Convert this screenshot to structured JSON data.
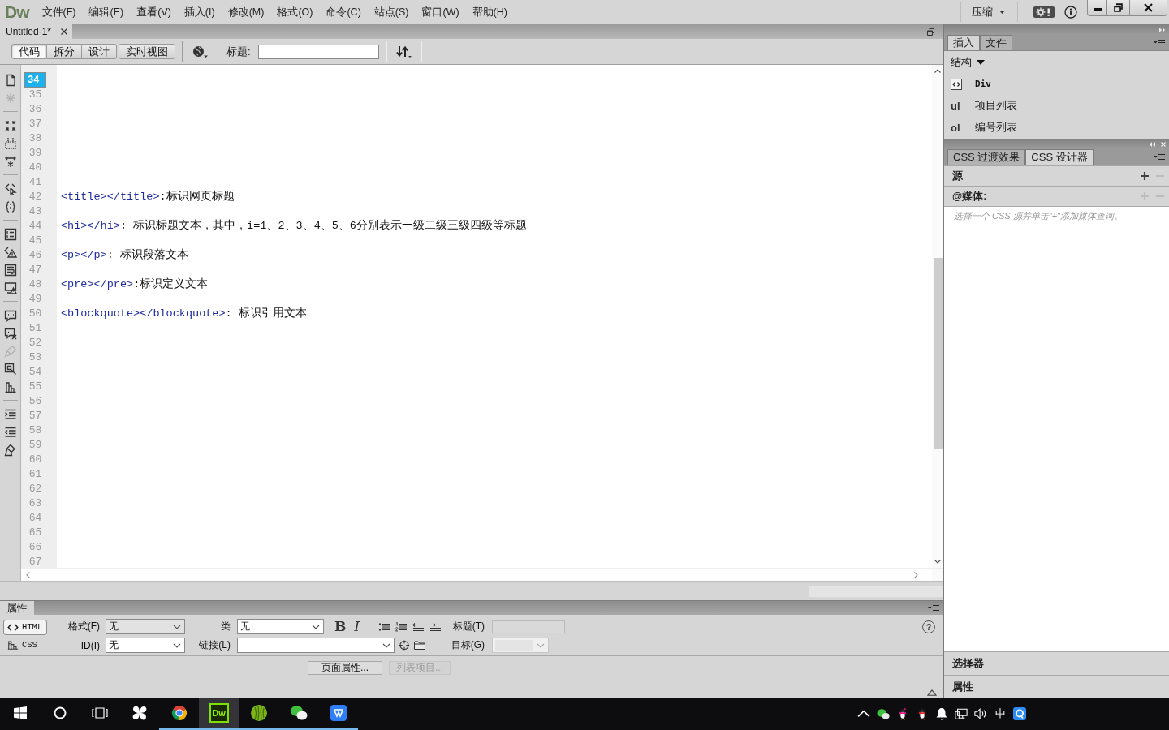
{
  "menu_bar": {
    "logo": "Dw",
    "items": [
      "文件(F)",
      "编辑(E)",
      "查看(V)",
      "插入(I)",
      "修改(M)",
      "格式(O)",
      "命令(C)",
      "站点(S)",
      "窗口(W)",
      "帮助(H)"
    ],
    "workspace": "压缩"
  },
  "document": {
    "title": "Untitled-1*"
  },
  "view_buttons": [
    {
      "label": "代码",
      "selected": true
    },
    {
      "label": "拆分",
      "selected": false
    },
    {
      "label": "设计",
      "selected": false
    },
    {
      "label": "实时视图",
      "selected": false
    }
  ],
  "title_field": {
    "label": "标题:"
  },
  "editor_tools": [
    {
      "tools": [
        {
          "disabled": false
        },
        {
          "disabled": true
        }
      ]
    },
    {
      "tools": [
        {
          "disabled": false
        },
        {
          "disabled": false
        },
        {
          "disabled": false
        }
      ]
    },
    {
      "tools": [
        {
          "disabled": false
        },
        {
          "disabled": false
        }
      ]
    },
    {
      "tools": [
        {
          "disabled": false
        },
        {
          "disabled": false
        },
        {
          "disabled": false
        },
        {
          "disabled": false
        }
      ]
    },
    {
      "tools": [
        {
          "disabled": false
        },
        {
          "disabled": false
        },
        {
          "disabled": true
        },
        {
          "disabled": false
        },
        {
          "disabled": false
        }
      ]
    },
    {
      "tools": [
        {
          "disabled": false
        },
        {
          "disabled": false
        },
        {
          "disabled": false
        }
      ]
    }
  ],
  "editor": {
    "lines": [
      {
        "number": "34",
        "selected": true
      },
      {
        "number": "35",
        "selected": false
      },
      {
        "number": "36",
        "selected": false
      },
      {
        "number": "37",
        "selected": false
      },
      {
        "number": "38",
        "selected": false
      },
      {
        "number": "39",
        "selected": false
      },
      {
        "number": "40",
        "selected": false
      },
      {
        "number": "41",
        "selected": false
      },
      {
        "number": "42",
        "selected": false,
        "tag": "<title></title>",
        "text": ":标识网页标题"
      },
      {
        "number": "43",
        "selected": false
      },
      {
        "number": "44",
        "selected": false,
        "tag": "<hi></hi>",
        "text": ": 标识标题文本，其中，i=1、2、3、4、5、6分别表示一级二级三级四级等标题"
      },
      {
        "number": "45",
        "selected": false
      },
      {
        "number": "46",
        "selected": false,
        "tag": "<p></p>",
        "text": ": 标识段落文本"
      },
      {
        "number": "47",
        "selected": false
      },
      {
        "number": "48",
        "selected": false,
        "tag": "<pre></pre>",
        "text": ":标识定义文本"
      },
      {
        "number": "49",
        "selected": false
      },
      {
        "number": "50",
        "selected": false,
        "tag": "<blockquote></blockquote>",
        "text": ": 标识引用文本"
      },
      {
        "number": "51",
        "selected": false
      },
      {
        "number": "52",
        "selected": false
      },
      {
        "number": "53",
        "selected": false
      },
      {
        "number": "54",
        "selected": false
      },
      {
        "number": "55",
        "selected": false
      },
      {
        "number": "56",
        "selected": false
      },
      {
        "number": "57",
        "selected": false
      },
      {
        "number": "58",
        "selected": false
      },
      {
        "number": "59",
        "selected": false
      },
      {
        "number": "60",
        "selected": false
      },
      {
        "number": "61",
        "selected": false
      },
      {
        "number": "62",
        "selected": false
      },
      {
        "number": "63",
        "selected": false
      },
      {
        "number": "64",
        "selected": false
      },
      {
        "number": "65",
        "selected": false
      },
      {
        "number": "66",
        "selected": false
      },
      {
        "number": "67",
        "selected": false
      }
    ]
  },
  "properties": {
    "title": "属性",
    "modes": [
      {
        "kind": "html",
        "label": "HTML",
        "selected": true
      },
      {
        "kind": "css",
        "label": "CSS",
        "selected": false
      }
    ],
    "format": {
      "label": "格式(F)",
      "value": "无",
      "hovered": true
    },
    "id": {
      "label": "ID(I)",
      "value": "无"
    },
    "class": {
      "label": "类",
      "value": "无"
    },
    "link": {
      "label": "链接(L)"
    },
    "bold": "B",
    "italic": "I",
    "heading": {
      "label": "标题(T)",
      "disabled": true
    },
    "target": {
      "label": "目标(G)",
      "disabled": true
    },
    "help": "?",
    "buttons": [
      {
        "label": "页面属性...",
        "disabled": false
      },
      {
        "label": "列表项目...",
        "disabled": true
      }
    ]
  },
  "insert_panel": {
    "tabs": [
      {
        "label": "插入",
        "selected": true
      },
      {
        "label": "文件",
        "selected": false
      }
    ],
    "category": "结构",
    "items": [
      {
        "kind": "icon",
        "label": "Div"
      },
      {
        "kind": "badge",
        "badge": "ul",
        "label": "项目列表"
      },
      {
        "kind": "badge",
        "badge": "ol",
        "label": "编号列表"
      }
    ]
  },
  "css_panel": {
    "tabs": [
      {
        "label": "CSS 过渡效果",
        "selected": false
      },
      {
        "label": "CSS 设计器",
        "selected": true
      }
    ],
    "sections": [
      {
        "title": "源",
        "add_disabled": false,
        "remove_disabled": true
      },
      {
        "title": "@媒体:",
        "add_disabled": true,
        "remove_disabled": true
      }
    ],
    "hint": "选择一个 CSS 源并单击\"+\"添加媒体查询。",
    "footer_sections": [
      "选择器",
      "属性"
    ]
  },
  "taskbar": {
    "apps": [
      {
        "running": false,
        "active": false
      },
      {
        "running": true,
        "active": false
      },
      {
        "label": "Dw",
        "running": true,
        "active": true
      },
      {
        "running": true,
        "active": false
      },
      {
        "running": true,
        "active": false
      },
      {
        "running": true,
        "active": false
      }
    ],
    "ime": "中"
  }
}
